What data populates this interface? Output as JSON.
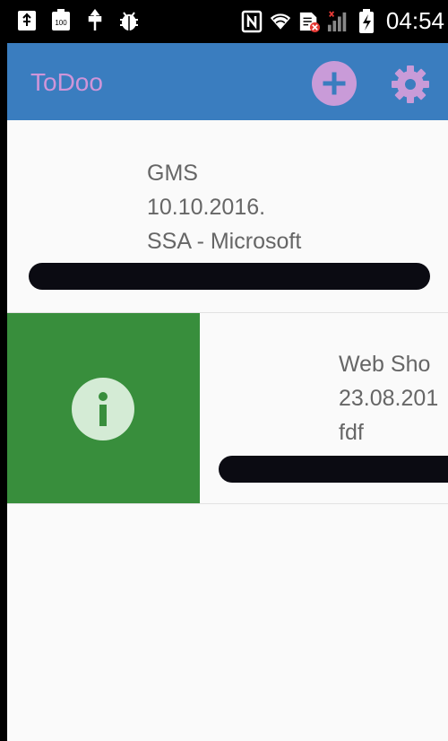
{
  "status_bar": {
    "time": "04:54",
    "left_icons": [
      "usb-icon",
      "battery-100-icon",
      "usb-debug-icon",
      "android-debug-icon"
    ],
    "right_icons": [
      "nfc-icon",
      "wifi-icon",
      "sim-error-icon",
      "signal-icon",
      "battery-charging-icon"
    ],
    "battery_indicator": "100"
  },
  "app_bar": {
    "title": "ToDoo",
    "color": "#3a7dbf",
    "title_color": "#cf95d9",
    "actions": [
      "add-icon",
      "settings-icon"
    ]
  },
  "todos": [
    {
      "title": "GMS",
      "date": "10.10.2016.",
      "subtitle": "SSA - Microsoft"
    },
    {
      "title": "Web Sho",
      "date": "23.08.201",
      "subtitle": "fdf",
      "swipe_action_icon": "info-icon",
      "swipe_action_color": "#388e3c"
    }
  ]
}
